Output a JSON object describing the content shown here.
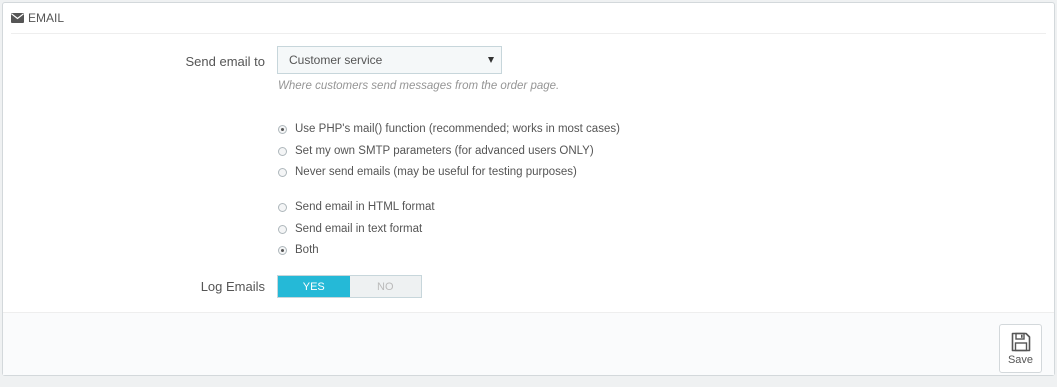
{
  "panel": {
    "title": "EMAIL",
    "icon": "envelope-icon"
  },
  "send_email_to": {
    "label": "Send email to",
    "selected": "Customer service",
    "help": "Where customers send messages from the order page."
  },
  "mail_method": {
    "options": [
      {
        "label": "Use PHP's mail() function (recommended; works in most cases)",
        "checked": true
      },
      {
        "label": "Set my own SMTP parameters (for advanced users ONLY)",
        "checked": false
      },
      {
        "label": "Never send emails (may be useful for testing purposes)",
        "checked": false
      }
    ]
  },
  "mail_format": {
    "options": [
      {
        "label": "Send email in HTML format",
        "checked": false
      },
      {
        "label": "Send email in text format",
        "checked": false
      },
      {
        "label": "Both",
        "checked": true
      }
    ]
  },
  "log_emails": {
    "label": "Log Emails",
    "yes": "YES",
    "no": "NO",
    "value": "YES"
  },
  "footer": {
    "save_label": "Save",
    "save_icon": "floppy-disk-icon"
  },
  "colors": {
    "accent": "#25b9d7",
    "text": "#555555",
    "help": "#959595"
  }
}
